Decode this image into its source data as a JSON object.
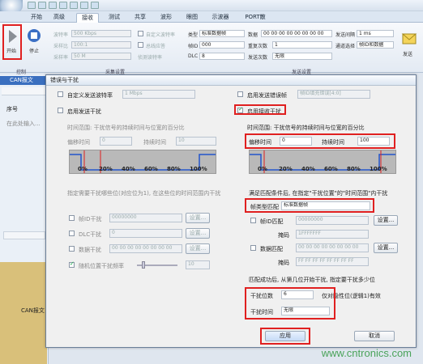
{
  "tabs": [
    "开始",
    "高级",
    "接收",
    "测试",
    "共享",
    "波形",
    "眼图",
    "示波器",
    "PORT散"
  ],
  "ribbon": {
    "start": "开始",
    "stop": "停止",
    "group_control": "控制",
    "group_sampling": "采集设置",
    "group_send": "发送设置",
    "send": "发送",
    "baud_label": "波特率",
    "baud_val": "500 Kbps",
    "sample_label": "采样比",
    "sample_val": "100:1",
    "rate_label": "采样率",
    "rate_val": "50 M",
    "custom_baud": "自定义波特率",
    "bus_reply": "总线应答",
    "idle_prob": "侦测读特率",
    "type_label": "类型",
    "type_val": "标准数据帧",
    "id_label": "帧ID",
    "id_val": "000",
    "dlc_label": "DLC",
    "dlc_val": "8",
    "data_label": "数据",
    "data_val": "00 00 00 00 00 00 00 00",
    "repeat_label": "重复次数",
    "repeat_val": "1",
    "send_count_label": "发送次数",
    "send_count_val": "无限",
    "interval_label": "发送间隔",
    "interval_val": "1 ms",
    "channel_label": "通道选择",
    "channel_val": "帧ID和数据"
  },
  "left": {
    "tab": "CAN报文",
    "col": "序号",
    "filter": "在此处输入...",
    "bottom_label": "CAN报文"
  },
  "dialog": {
    "title": "错误与干扰",
    "custom_baud": "自定义发送波特率",
    "baud_val": "1 Mbps",
    "enable_send": "启用发送干扰",
    "range_text": "时间范围: 干扰信号的持续时间与位宽的百分比",
    "offset_label": "偏移时间",
    "offset_val": "0",
    "duration_label": "持续时间",
    "duration_val": "10",
    "pcts": [
      "0%",
      "20%",
      "40%",
      "60%",
      "80%",
      "100%"
    ],
    "desc_left": "指定需要干扰哪些位(对应位为1), 在这些位的时间范围内干扰",
    "rows": [
      {
        "label": "帧ID干扰",
        "val": "00000000",
        "btn": "设置..."
      },
      {
        "label": "DLC干扰",
        "val": "0",
        "btn": "设置..."
      },
      {
        "label": "数据干扰",
        "val": "00 00 00 00 00 00 00 00",
        "btn": "设置..."
      }
    ],
    "random_label": "随机位置干扰频率",
    "random_val": "10",
    "enable_error_frame": "启用发送错误帧",
    "frame_fill": "帧ID填充错误[4:0]",
    "enable_recv": "启用接收干扰",
    "r_offset_val": "0",
    "r_duration_val": "100",
    "desc_right": "满足匹配条件后, 在指定\"干扰位置\"的\"时间范围\"内干扰",
    "frame_type_label": "帧类型匹配",
    "frame_type_val": "标准数据帧",
    "id_match": "帧ID匹配",
    "id_match_val": "00000000",
    "mask_label": "掩码",
    "mask_val": "1FFFFFFF",
    "data_match": "数据匹配",
    "data_match_val": "00 00 00 00 00 00 00 00",
    "mask2_val": "FF FF FF FF FF FF FF FF",
    "match_desc": "匹配成功后, 从第几位开始干扰, 指定要干扰多少位",
    "pos_label": "干扰位数",
    "pos_val": "6",
    "pos_suffix": "仅对隐性位(逻辑1)有效",
    "time_label": "干扰时间",
    "time_val": "无限",
    "apply": "应用",
    "cancel": "取消"
  },
  "watermark": "www.cntronics.com",
  "colors": {
    "red": "#e02020",
    "blue": "#2255cc"
  }
}
